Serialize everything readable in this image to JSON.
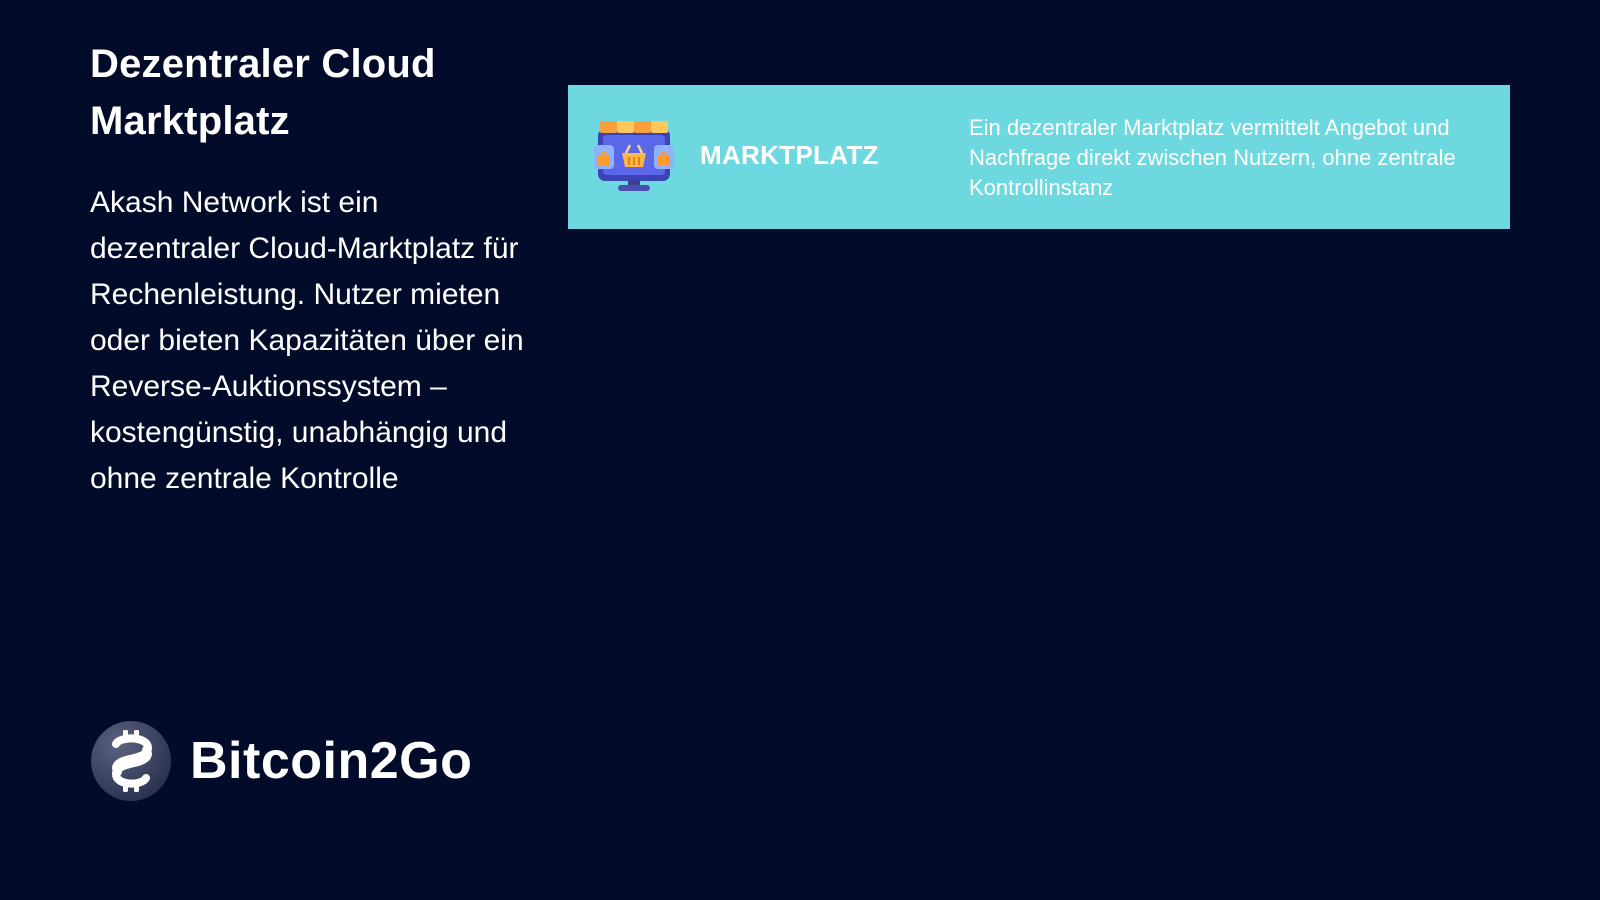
{
  "title": "Dezentraler Cloud Marktplatz",
  "description": "Akash Network ist ein dezentraler Cloud-Marktplatz für Rechenleistung. Nutzer mieten oder bieten Kapazitäten über ein Reverse-Auktionssystem – kostengünstig, unabhängig und ohne zentrale Kontrolle",
  "card": {
    "icon": "marketplace-monitor-icon",
    "label": "MARKTPLATZ",
    "text": "Ein dezentraler Marktplatz vermittelt Angebot und Nachfrage direkt zwischen Nutzern, ohne zentrale Kontrollinstanz",
    "background": "#6dd8df"
  },
  "brand": {
    "logo_icon": "bitcoin2go-logo-icon",
    "name": "Bitcoin2Go"
  },
  "colors": {
    "background": "#020b29",
    "text": "#ffffff"
  }
}
